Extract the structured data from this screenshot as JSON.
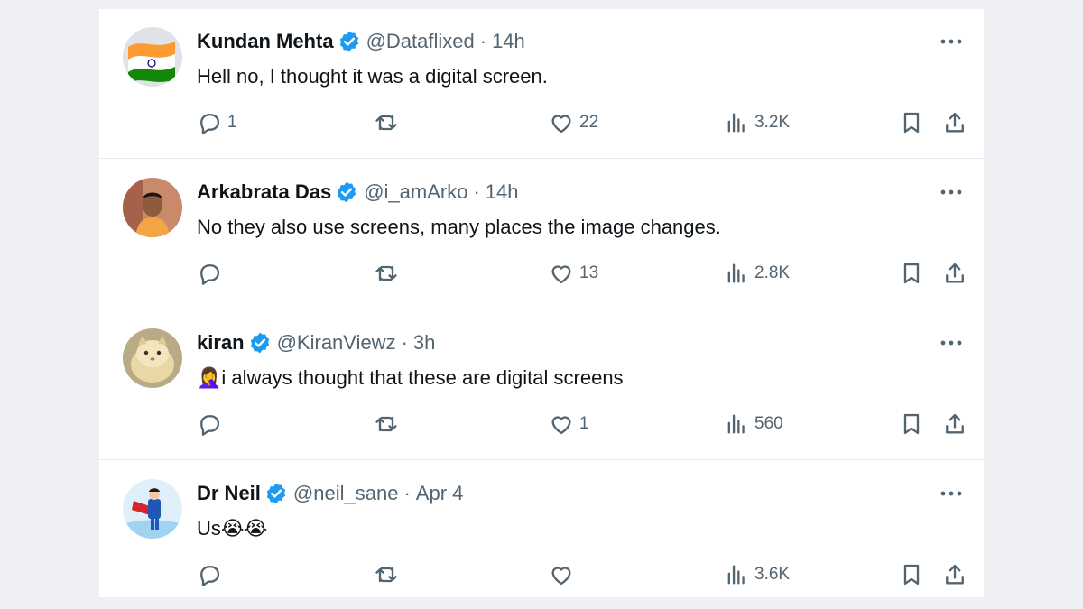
{
  "posts": [
    {
      "name": "Kundan Mehta",
      "handle": "@Dataflixed",
      "separator": "·",
      "time": "14h",
      "text": "Hell no, I thought it was a digital screen.",
      "emoji": "",
      "replies": "1",
      "retweets": "",
      "likes": "22",
      "views": "3.2K",
      "avatar": "india-flag"
    },
    {
      "name": "Arkabrata Das",
      "handle": "@i_amArko",
      "separator": "·",
      "time": "14h",
      "text": "No they also use screens, many places the image changes.",
      "emoji": "",
      "replies": "",
      "retweets": "",
      "likes": "13",
      "views": "2.8K",
      "avatar": "person-photo"
    },
    {
      "name": "kiran",
      "handle": "@KiranViewz",
      "separator": "·",
      "time": "3h",
      "text": " i always thought that these are digital screens",
      "emoji": "🤦‍♀️",
      "replies": "",
      "retweets": "",
      "likes": "1",
      "views": "560",
      "avatar": "cat-photo"
    },
    {
      "name": "Dr Neil",
      "handle": "@neil_sane",
      "separator": "·",
      "time": "Apr 4",
      "text": "Us",
      "emoji": "😭😭",
      "replies": "",
      "retweets": "",
      "likes": "",
      "views": "3.6K",
      "avatar": "superhero-illustration"
    }
  ],
  "colors": {
    "verified": "#1d9bf0",
    "secondary_text": "#536471",
    "primary_text": "#0f1419",
    "divider": "#e8eaed",
    "page_background": "#eef0f3"
  },
  "icons": {
    "reply": "reply-bubble-icon",
    "retweet": "retweet-icon",
    "like": "heart-icon",
    "views": "analytics-bars-icon",
    "bookmark": "bookmark-icon",
    "share": "share-upload-icon",
    "more": "more-dots-icon",
    "verified": "verified-badge-icon"
  }
}
